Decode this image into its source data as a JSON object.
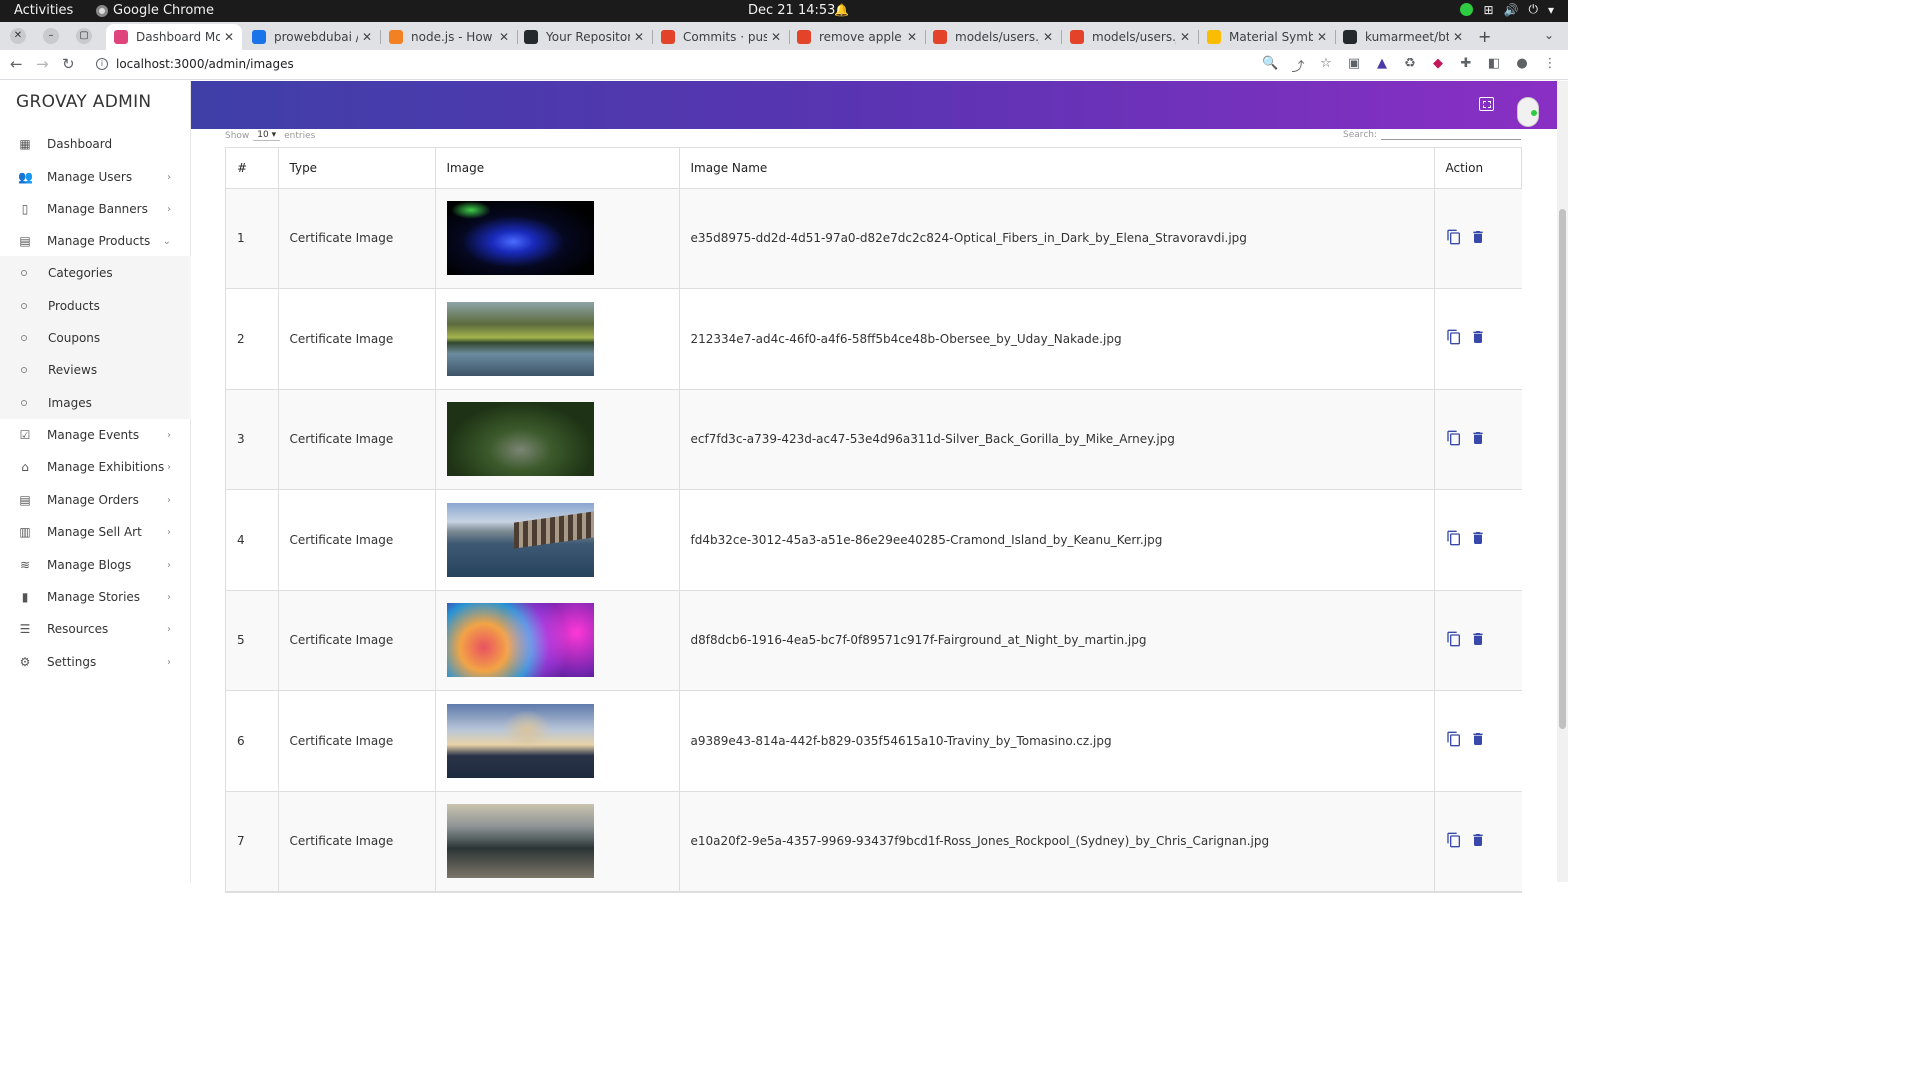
{
  "os_bar": {
    "activities": "Activities",
    "app_name": "Google Chrome",
    "clock": "Dec 21  14:53"
  },
  "tabs": [
    {
      "title": "Dashboard Mo",
      "color": "#e0447c",
      "active": true
    },
    {
      "title": "prowebdubai /",
      "color": "#1a73e8"
    },
    {
      "title": "node.js - How t",
      "color": "#f48024"
    },
    {
      "title": "Your Repositor",
      "color": "#24292e"
    },
    {
      "title": "Commits · push",
      "color": "#e24329"
    },
    {
      "title": "remove apple a",
      "color": "#e24329"
    },
    {
      "title": "models/users.j",
      "color": "#e24329"
    },
    {
      "title": "models/users.j",
      "color": "#e24329"
    },
    {
      "title": "Material Symbo",
      "color": "#fbbc04"
    },
    {
      "title": "kumarmeet/bt",
      "color": "#24292e"
    }
  ],
  "address": {
    "url": "localhost:3000/admin/images"
  },
  "sidebar": {
    "brand": "GROVAY ADMIN",
    "items": [
      {
        "label": "Dashboard",
        "icon": "dashboard-icon",
        "chevron": false
      },
      {
        "label": "Manage Users",
        "icon": "users-icon",
        "chevron": true
      },
      {
        "label": "Manage Banners",
        "icon": "banner-icon",
        "chevron": true
      },
      {
        "label": "Manage Products",
        "icon": "products-icon",
        "chevron": true,
        "expanded": true
      },
      {
        "label": "Manage Events",
        "icon": "events-icon",
        "chevron": true
      },
      {
        "label": "Manage Exhibitions",
        "icon": "exhibitions-icon",
        "chevron": true
      },
      {
        "label": "Manage Orders",
        "icon": "orders-icon",
        "chevron": true
      },
      {
        "label": "Manage Sell Art",
        "icon": "store-icon",
        "chevron": true
      },
      {
        "label": "Manage Blogs",
        "icon": "rss-icon",
        "chevron": true
      },
      {
        "label": "Manage Stories",
        "icon": "stories-icon",
        "chevron": true
      },
      {
        "label": "Resources",
        "icon": "list-icon",
        "chevron": true
      },
      {
        "label": "Settings",
        "icon": "gear-icon",
        "chevron": true
      }
    ],
    "sub_items": [
      "Categories",
      "Products",
      "Coupons",
      "Reviews",
      "Images"
    ]
  },
  "table_controls": {
    "show_label": "Show",
    "show_value": "10",
    "entries_label": "entries",
    "search_label": "Search:"
  },
  "table": {
    "headers": [
      "#",
      "Type",
      "Image",
      "Image Name",
      "Action"
    ],
    "rows": [
      {
        "num": "1",
        "type": "Certificate Image",
        "name": "e35d8975-dd2d-4d51-97a0-d82e7dc2c824-Optical_Fibers_in_Dark_by_Elena_Stravoravdi.jpg"
      },
      {
        "num": "2",
        "type": "Certificate Image",
        "name": "212334e7-ad4c-46f0-a4f6-58ff5b4ce48b-Obersee_by_Uday_Nakade.jpg"
      },
      {
        "num": "3",
        "type": "Certificate Image",
        "name": "ecf7fd3c-a739-423d-ac47-53e4d96a311d-Silver_Back_Gorilla_by_Mike_Arney.jpg"
      },
      {
        "num": "4",
        "type": "Certificate Image",
        "name": "fd4b32ce-3012-45a3-a51e-86e29ee40285-Cramond_Island_by_Keanu_Kerr.jpg"
      },
      {
        "num": "5",
        "type": "Certificate Image",
        "name": "d8f8dcb6-1916-4ea5-bc7f-0f89571c917f-Fairground_at_Night_by_martin.jpg"
      },
      {
        "num": "6",
        "type": "Certificate Image",
        "name": "a9389e43-814a-442f-b829-035f54615a10-Traviny_by_Tomasino.cz.jpg"
      },
      {
        "num": "7",
        "type": "Certificate Image",
        "name": "e10a20f2-9e5a-4357-9969-93437f9bcd1f-Ross_Jones_Rockpool_(Sydney)_by_Chris_Carignan.jpg"
      }
    ]
  },
  "colors": {
    "header_start": "#3f3fa8",
    "header_end": "#8a2fc4",
    "action_icon": "#3949ab"
  }
}
